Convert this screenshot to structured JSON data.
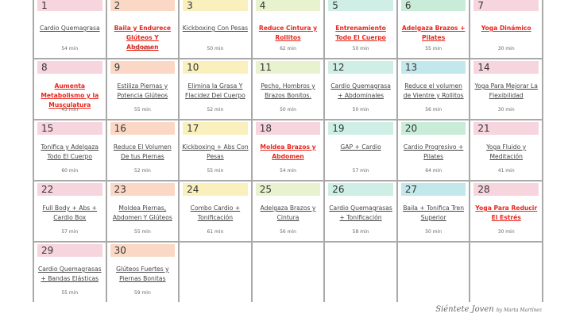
{
  "colors": {
    "pink": "#f7d5df",
    "salmon": "#fbd8c6",
    "yellow": "#faf0bd",
    "green": "#e8f2cf",
    "teal": "#cfeee6",
    "mint": "#c9ecd9",
    "blue": "#c3e8ec",
    "highlight_text": "#e8251c"
  },
  "days": [
    {
      "n": "1",
      "title": "Cardio Quemagrasa",
      "mins": "54 min",
      "color": "pink",
      "red": false
    },
    {
      "n": "2",
      "title": "Baila y Endurece Glúteos Y Abdomen",
      "mins": "51 min",
      "color": "salmon",
      "red": true
    },
    {
      "n": "3",
      "title": "Kickboxing Con Pesas",
      "mins": "50 min",
      "color": "yellow",
      "red": false
    },
    {
      "n": "4",
      "title": "Reduce Cintura y Rollitos",
      "mins": "62 min",
      "color": "green",
      "red": true
    },
    {
      "n": "5",
      "title": "Entrenamiento Todo El Cuerpo",
      "mins": "50 min",
      "color": "teal",
      "red": true
    },
    {
      "n": "6",
      "title": "Adelgaza Brazos + Pilates",
      "mins": "55 min",
      "color": "mint",
      "red": true
    },
    {
      "n": "7",
      "title": "Yoga Dinámico",
      "mins": "30 min",
      "color": "pink",
      "red": true
    },
    {
      "n": "8",
      "title": "Aumenta Metabolismo y la Musculatura",
      "mins": "43 min",
      "color": "pink",
      "red": true
    },
    {
      "n": "9",
      "title": "Estiliza Piernas y Potencia Glúteos",
      "mins": "55 min",
      "color": "salmon",
      "red": false
    },
    {
      "n": "10",
      "title": "Elimina la Grasa Y Flacidez Del Cuerpo",
      "mins": "52 min",
      "color": "yellow",
      "red": false
    },
    {
      "n": "11",
      "title": "Pecho, Hombros y Brazos Bonitos.",
      "mins": "50 min",
      "color": "green",
      "red": false
    },
    {
      "n": "12",
      "title": "Cardio Quemagrasa + Abdominales",
      "mins": "50 min",
      "color": "teal",
      "red": false
    },
    {
      "n": "13",
      "title": "Reduce el volumen de Vientre y Rollitos",
      "mins": "56 min",
      "color": "blue",
      "red": false
    },
    {
      "n": "14",
      "title": "Yoga Para Mejorar La Flexibilidad",
      "mins": "30 min",
      "color": "pink",
      "red": false
    },
    {
      "n": "15",
      "title": "Tonifica y Adelgaza Todo El Cuerpo",
      "mins": "60 min",
      "color": "pink",
      "red": false
    },
    {
      "n": "16",
      "title": "Reduce El Volumen De tus Piernas",
      "mins": "52 min",
      "color": "salmon",
      "red": false
    },
    {
      "n": "17",
      "title": "Kickboxing + Abs Con Pesas",
      "mins": "55 min",
      "color": "yellow",
      "red": false
    },
    {
      "n": "18",
      "title": "Moldea Brazos y Abdomen",
      "mins": "54 min",
      "color": "pink",
      "red": true
    },
    {
      "n": "19",
      "title": "GAP + Cardio",
      "mins": "57 min",
      "color": "teal",
      "red": false
    },
    {
      "n": "20",
      "title": "Cardio Progresivo + Pilates",
      "mins": "64 min",
      "color": "mint",
      "red": false
    },
    {
      "n": "21",
      "title": "Yoga Fluido y Meditación",
      "mins": "41 min",
      "color": "pink",
      "red": false
    },
    {
      "n": "22",
      "title": "Full Body + Abs + Cardio Box",
      "mins": "57 min",
      "color": "pink",
      "red": false
    },
    {
      "n": "23",
      "title": "Moldea Piernas, Abdomen Y Glúteos",
      "mins": "55 min",
      "color": "salmon",
      "red": false
    },
    {
      "n": "24",
      "title": "Combo Cardio + Tonificación",
      "mins": "61 min",
      "color": "yellow",
      "red": false
    },
    {
      "n": "25",
      "title": "Adelgaza Brazos y Cintura",
      "mins": "56 min",
      "color": "green",
      "red": false
    },
    {
      "n": "26",
      "title": "Cardio Quemagrasas + Tonificación",
      "mins": "58 min",
      "color": "teal",
      "red": false
    },
    {
      "n": "27",
      "title": "Baila + Tonifica Tren Superior",
      "mins": "50 min",
      "color": "blue",
      "red": false
    },
    {
      "n": "28",
      "title": "Yoga Para Reducir El Estrés",
      "mins": "30 min",
      "color": "pink",
      "red": true
    },
    {
      "n": "29",
      "title": "Cardio Quemagrasas + Bandas Elásticas",
      "mins": "55 min",
      "color": "pink",
      "red": false
    },
    {
      "n": "30",
      "title": "Glúteos Fuertes y Piernas Bonitas",
      "mins": "59 min",
      "color": "salmon",
      "red": false
    }
  ],
  "signature": {
    "brand": "Siéntete Joven",
    "by": "by Marta Martínez"
  }
}
